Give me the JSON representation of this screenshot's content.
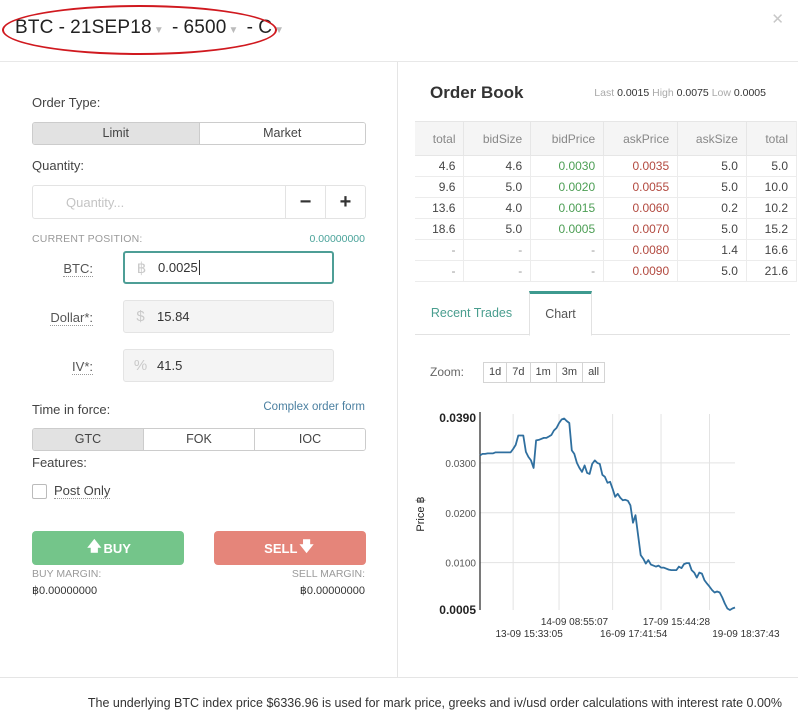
{
  "header": {
    "instrument": "BTC",
    "expiry": "21SEP18",
    "strike": "6500",
    "option_type": "C",
    "separator": "-",
    "close_icon": "close-icon"
  },
  "order_form": {
    "order_type_label": "Order Type:",
    "order_types": [
      {
        "label": "Limit",
        "active": true
      },
      {
        "label": "Market",
        "active": false
      }
    ],
    "quantity_label": "Quantity:",
    "quantity_placeholder": "Quantity...",
    "quantity_value": "",
    "minus_label": "−",
    "plus_label": "+",
    "current_position_label": "CURRENT POSITION:",
    "current_position_value": "0.00000000",
    "btc_label": "BTC:",
    "btc_icon": "฿",
    "btc_value": "0.0025",
    "dollar_label": "Dollar*:",
    "dollar_icon": "$",
    "dollar_value": "15.84",
    "iv_label": "IV*:",
    "iv_icon": "%",
    "iv_value": "41.5",
    "time_in_force_label": "Time in force:",
    "complex_order_link": "Complex order form",
    "time_in_force_options": [
      {
        "label": "GTC",
        "active": true
      },
      {
        "label": "FOK",
        "active": false
      },
      {
        "label": "IOC",
        "active": false
      }
    ],
    "features_label": "Features:",
    "post_only_label": "Post Only",
    "post_only_checked": false,
    "buy_label": "BUY",
    "sell_label": "SELL",
    "buy_margin_label": "BUY MARGIN:",
    "buy_margin_value": "฿0.00000000",
    "sell_margin_label": "SELL MARGIN:",
    "sell_margin_value": "฿0.00000000"
  },
  "order_book": {
    "title": "Order Book",
    "last_label": "Last",
    "last_value": "0.0015",
    "high_label": "High",
    "high_value": "0.0075",
    "low_label": "Low",
    "low_value": "0.0005",
    "columns": [
      "total",
      "bidSize",
      "bidPrice",
      "askPrice",
      "askSize",
      "total"
    ],
    "rows": [
      [
        "4.6",
        "4.6",
        "0.0030",
        "0.0035",
        "5.0",
        "5.0"
      ],
      [
        "9.6",
        "5.0",
        "0.0020",
        "0.0055",
        "5.0",
        "10.0"
      ],
      [
        "13.6",
        "4.0",
        "0.0015",
        "0.0060",
        "0.2",
        "10.2"
      ],
      [
        "18.6",
        "5.0",
        "0.0005",
        "0.0070",
        "5.0",
        "15.2"
      ],
      [
        "-",
        "-",
        "-",
        "0.0080",
        "1.4",
        "16.6"
      ],
      [
        "-",
        "-",
        "-",
        "0.0090",
        "5.0",
        "21.6"
      ]
    ],
    "colors": {
      "bid": "#4c9e54",
      "ask": "#b34a40"
    }
  },
  "tabs": [
    {
      "label": "Recent Trades",
      "active": false
    },
    {
      "label": "Chart",
      "active": true
    }
  ],
  "chart_controls": {
    "zoom_label": "Zoom:",
    "zoom_options": [
      "1d",
      "7d",
      "1m",
      "3m",
      "all"
    ]
  },
  "chart_data": {
    "type": "line",
    "title": "",
    "xlabel": "",
    "ylabel": "Price ฿",
    "ylim": [
      0.0005,
      0.039
    ],
    "y_ticks": [
      "0.0390",
      "0.0300",
      "0.0200",
      "0.0100",
      "0.0005"
    ],
    "x_ticks_upper": [
      "14-09 08:55:07",
      "17-09 15:44:28"
    ],
    "x_ticks_lower": [
      "13-09 15:33:05",
      "16-09 17:41:54",
      "19-09 18:37:43"
    ],
    "grid": true,
    "line_color": "#2f6f9f",
    "series": [
      {
        "name": "price",
        "x": [
          0,
          1,
          2,
          3,
          4,
          5,
          6,
          7,
          8,
          9,
          10,
          11,
          12,
          13,
          14,
          15,
          16,
          17,
          18,
          19,
          20,
          21,
          22,
          23,
          24,
          25,
          26,
          27,
          28,
          29,
          30,
          31,
          32,
          33,
          34,
          35,
          36,
          37,
          38,
          39,
          40,
          41,
          42,
          43,
          44,
          45,
          46,
          47,
          48,
          49,
          50,
          51,
          52,
          53,
          54,
          55,
          56,
          57,
          58,
          59,
          60,
          61,
          62,
          63,
          64,
          65,
          66,
          67,
          68,
          69,
          70,
          71,
          72,
          73,
          74,
          75,
          76,
          77,
          78,
          79,
          80,
          81,
          82,
          83,
          84,
          85,
          86,
          87,
          88,
          89,
          90,
          91,
          92,
          93,
          94,
          95,
          96,
          97,
          98,
          99,
          100
        ],
        "values": [
          0.0315,
          0.0318,
          0.0318,
          0.0319,
          0.0319,
          0.0319,
          0.0321,
          0.0321,
          0.0321,
          0.0321,
          0.0321,
          0.0321,
          0.0321,
          0.0328,
          0.0336,
          0.0355,
          0.0355,
          0.0355,
          0.0322,
          0.0312,
          0.0305,
          0.029,
          0.0345,
          0.0346,
          0.0348,
          0.035,
          0.035,
          0.0353,
          0.0356,
          0.0365,
          0.037,
          0.038,
          0.0387,
          0.0389,
          0.0384,
          0.038,
          0.0325,
          0.0318,
          0.03,
          0.029,
          0.0282,
          0.0295,
          0.028,
          0.0278,
          0.0298,
          0.0305,
          0.03,
          0.0298,
          0.0276,
          0.0272,
          0.026,
          0.0262,
          0.0248,
          0.0232,
          0.0238,
          0.023,
          0.0225,
          0.0226,
          0.0224,
          0.0215,
          0.018,
          0.0195,
          0.0155,
          0.0115,
          0.0108,
          0.0098,
          0.0105,
          0.0096,
          0.0094,
          0.0092,
          0.0094,
          0.009,
          0.009,
          0.0088,
          0.0086,
          0.0085,
          0.0085,
          0.0085,
          0.0092,
          0.0089,
          0.0097,
          0.0099,
          0.0099,
          0.0085,
          0.008,
          0.007,
          0.008,
          0.0078,
          0.0065,
          0.0058,
          0.0052,
          0.0045,
          0.004,
          0.0042,
          0.004,
          0.003,
          0.0018,
          0.0008,
          0.0005,
          0.0008,
          0.001
        ]
      }
    ]
  },
  "footer": {
    "text": "The underlying BTC index price $6336.96 is used for mark price, greeks and iv/usd order calculations with interest rate 0.00%"
  }
}
